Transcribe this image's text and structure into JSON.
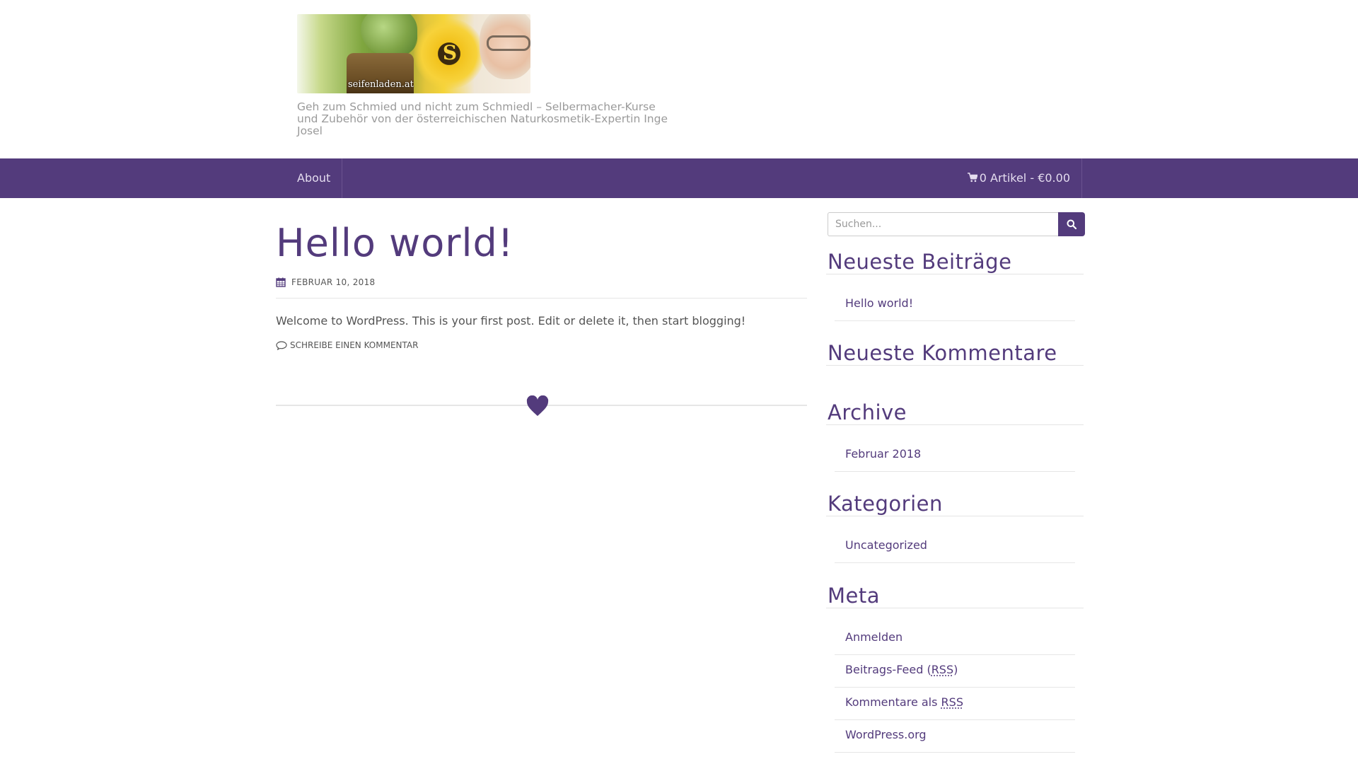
{
  "header": {
    "logo_text": "seifenladen.at",
    "logo_letter": "S",
    "tagline": "Geh zum Schmied und nicht zum Schmiedl – Selbermacher-Kurse und Zubehör von der österreichischen Naturkosmetik-Expertin Inge Josel"
  },
  "nav": {
    "about": "About",
    "cart": "0 Artikel - €0.00"
  },
  "post": {
    "title": "Hello world!",
    "date": "FEBRUAR 10, 2018",
    "content": "Welcome to WordPress. This is your first post. Edit or delete it, then start blogging!",
    "comment_link": "SCHREIBE EINEN KOMMENTAR"
  },
  "sidebar": {
    "search_placeholder": "Suchen...",
    "recent_posts": {
      "title": "Neueste Beiträge",
      "items": [
        "Hello world!"
      ]
    },
    "recent_comments": {
      "title": "Neueste Kommentare"
    },
    "archive": {
      "title": "Archive",
      "items": [
        "Februar 2018"
      ]
    },
    "categories": {
      "title": "Kategorien",
      "items": [
        "Uncategorized"
      ]
    },
    "meta": {
      "title": "Meta",
      "login": "Anmelden",
      "entries_feed_prefix": "Beitrags-Feed (",
      "rss": "RSS",
      "entries_feed_suffix": ")",
      "comments_feed_prefix": "Kommentare als ",
      "wordpress": "WordPress.org"
    }
  },
  "colors": {
    "brand": "#533b7c",
    "text": "#555555"
  }
}
